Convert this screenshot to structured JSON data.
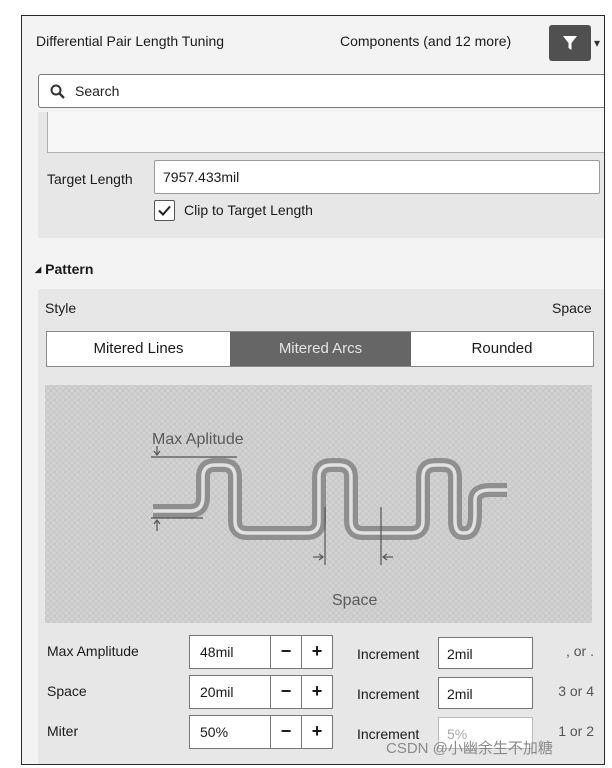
{
  "header": {
    "title": "Differential Pair Length Tuning",
    "components": "Components (and 12 more)",
    "filter_icon": "filter-icon"
  },
  "search": {
    "placeholder": "Search",
    "icon": "search-icon"
  },
  "target_length": {
    "label": "Target Length",
    "value": "7957.433mil"
  },
  "clip": {
    "label": "Clip to Target Length",
    "checked": true
  },
  "pattern": {
    "title": "Pattern",
    "style_label": "Style",
    "space_label": "Space",
    "styles": [
      "Mitered Lines",
      "Mitered Arcs",
      "Rounded"
    ],
    "selected_style": "Mitered Arcs"
  },
  "diagram": {
    "amplitude_label": "Max Aplitude",
    "space_label": "Space"
  },
  "params": [
    {
      "label": "Max Amplitude",
      "value": "48mil",
      "increment_label": "Increment",
      "increment": "2mil",
      "note": ", or ."
    },
    {
      "label": "Space",
      "value": "20mil",
      "increment_label": "Increment",
      "increment": "2mil",
      "note": "3 or 4"
    },
    {
      "label": "Miter",
      "value": "50%",
      "increment_label": "Increment",
      "increment": "5%",
      "note": "1 or 2"
    }
  ],
  "controls": {
    "minus": "−",
    "plus": "+"
  },
  "watermark": "CSDN @小幽余生不加糖"
}
